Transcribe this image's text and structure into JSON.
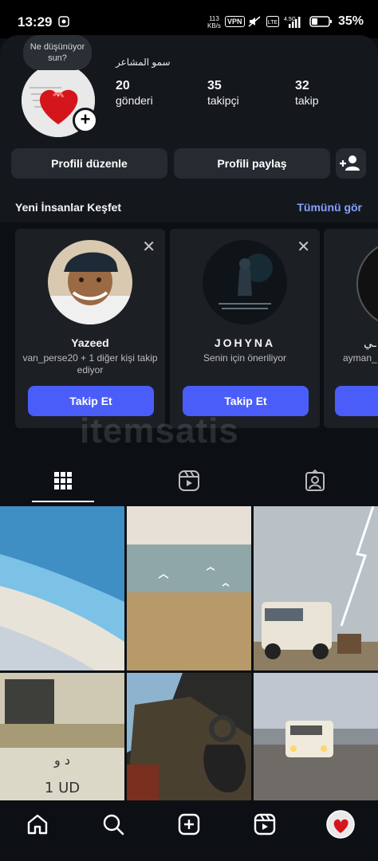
{
  "status_bar": {
    "time": "13:29",
    "net_speed_value": "113",
    "net_speed_unit": "KB/s",
    "vpn": "VPN",
    "battery": "35%"
  },
  "profile": {
    "note": "Ne düşünüyor sun?",
    "name": "سمو المشاعر",
    "stats": [
      {
        "count": "20",
        "label": "gönderi"
      },
      {
        "count": "35",
        "label": "takipçi"
      },
      {
        "count": "32",
        "label": "takip"
      }
    ]
  },
  "actions": {
    "edit_profile": "Profili düzenle",
    "share_profile": "Profili paylaş",
    "add_person_icon": "add-person-icon"
  },
  "discover": {
    "title": "Yeni İnsanlar Keşfet",
    "see_all": "Tümünü gör",
    "cards": [
      {
        "name": "Yazeed",
        "subtitle": "van_perse20 + 1 diğer kişi takip ediyor",
        "button": "Takip Et"
      },
      {
        "name": "JOHYNA",
        "subtitle": "Senin için öneriliyor",
        "button": "Takip Et"
      },
      {
        "name": "ـي",
        "subtitle": "ayman_ t",
        "button": ""
      }
    ]
  },
  "watermark": "itemsatis",
  "tabs": [
    {
      "icon": "grid-icon",
      "active": true
    },
    {
      "icon": "reels-icon",
      "active": false
    },
    {
      "icon": "tagged-icon",
      "active": false
    }
  ],
  "bottom_nav": [
    {
      "icon": "home-icon"
    },
    {
      "icon": "search-icon"
    },
    {
      "icon": "create-icon"
    },
    {
      "icon": "reels-icon"
    },
    {
      "icon": "profile-avatar-icon"
    }
  ],
  "colors": {
    "background": "#0c1014",
    "surface": "#262b31",
    "accent": "#4a5df9",
    "link": "#85a1ff"
  }
}
